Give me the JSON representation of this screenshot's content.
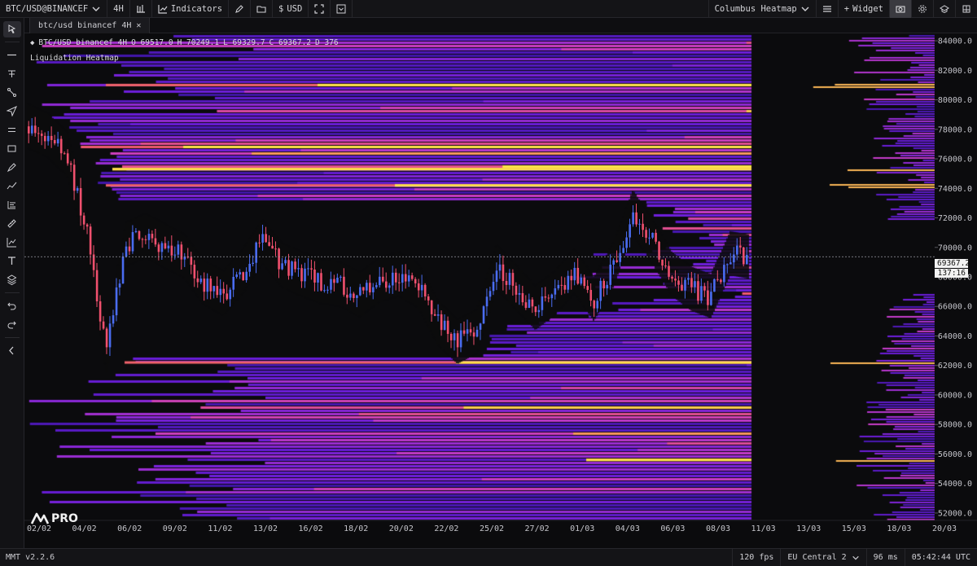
{
  "topbar": {
    "symbol": "BTC/USD@BINANCEF",
    "interval": "4H",
    "indicators_label": "Indicators",
    "currency_label": "USD",
    "heatmap_label": "Columbus Heatmap",
    "widget_label": "Widget"
  },
  "tab": {
    "label": "btc/usd binancef 4H",
    "close": "✕"
  },
  "legend": {
    "symbol": "BTC/USD binancef 4H",
    "o": "O 69517.0",
    "h": "H 70249.1",
    "l": "L 69329.7",
    "c": "C 69367.2",
    "d": "D 376",
    "study": "Liquidation Heatmap"
  },
  "price_marker": {
    "price": "69367.2",
    "countdown": "137:16"
  },
  "logo": {
    "text": "PRO"
  },
  "status": {
    "version": "MMT v2.2.6",
    "fps": "120 fps",
    "region": "EU Central 2",
    "latency": "96 ms",
    "clock": "05:42:44 UTC"
  },
  "colors": {
    "bull": "#4a6cf0",
    "bear": "#f0506e",
    "heat_low": "#3a1fc4",
    "heat_mid": "#b040d8",
    "heat_high": "#ffe24a",
    "background": "#0b0b0d"
  },
  "chart_data": {
    "type": "heatmap",
    "y_axis": {
      "range": [
        51500,
        84500
      ],
      "ticks": [
        "84000.0",
        "82000.0",
        "80000.0",
        "78000.0",
        "76000.0",
        "74000.0",
        "72000.0",
        "70000.0",
        "68000.0",
        "66000.0",
        "64000.0",
        "62000.0",
        "60000.0",
        "58000.0",
        "56000.0",
        "54000.0",
        "52000.0"
      ]
    },
    "x_axis": {
      "ticks": [
        "02/02",
        "04/02",
        "06/02",
        "09/02",
        "11/02",
        "13/02",
        "16/02",
        "18/02",
        "20/02",
        "22/02",
        "25/02",
        "27/02",
        "01/03",
        "04/03",
        "06/03",
        "08/03",
        "11/03",
        "13/03",
        "15/03",
        "18/03",
        "20/03"
      ],
      "last_candle_date": "11/03"
    },
    "candles_close_path": [
      [
        "02/02",
        78200
      ],
      [
        "03/02",
        77600
      ],
      [
        "04/02",
        76300
      ],
      [
        "05/02",
        71000
      ],
      [
        "06/02",
        63000
      ],
      [
        "07/02",
        70200
      ],
      [
        "08/02",
        70800
      ],
      [
        "09/02",
        70100
      ],
      [
        "10/02",
        69400
      ],
      [
        "11/02",
        67600
      ],
      [
        "12/02",
        66900
      ],
      [
        "13/02",
        68400
      ],
      [
        "14/02",
        70400
      ],
      [
        "15/02",
        68800
      ],
      [
        "16/02",
        68200
      ],
      [
        "17/02",
        67700
      ],
      [
        "18/02",
        67500
      ],
      [
        "19/02",
        66800
      ],
      [
        "20/02",
        67800
      ],
      [
        "21/02",
        68200
      ],
      [
        "22/02",
        67400
      ],
      [
        "23/02",
        64900
      ],
      [
        "24/02",
        63600
      ],
      [
        "25/02",
        64300
      ],
      [
        "26/02",
        68700
      ],
      [
        "27/02",
        67300
      ],
      [
        "28/02",
        65900
      ],
      [
        "01/03",
        66900
      ],
      [
        "02/03",
        68400
      ],
      [
        "03/03",
        66500
      ],
      [
        "04/03",
        68800
      ],
      [
        "05/03",
        72400
      ],
      [
        "06/03",
        70400
      ],
      [
        "07/03",
        68200
      ],
      [
        "08/03",
        67200
      ],
      [
        "09/03",
        66700
      ],
      [
        "10/03",
        69600
      ],
      [
        "11/03",
        69367
      ]
    ],
    "liquidation_levels_bright": [
      81000,
      75300,
      74200,
      62200,
      55600
    ]
  }
}
